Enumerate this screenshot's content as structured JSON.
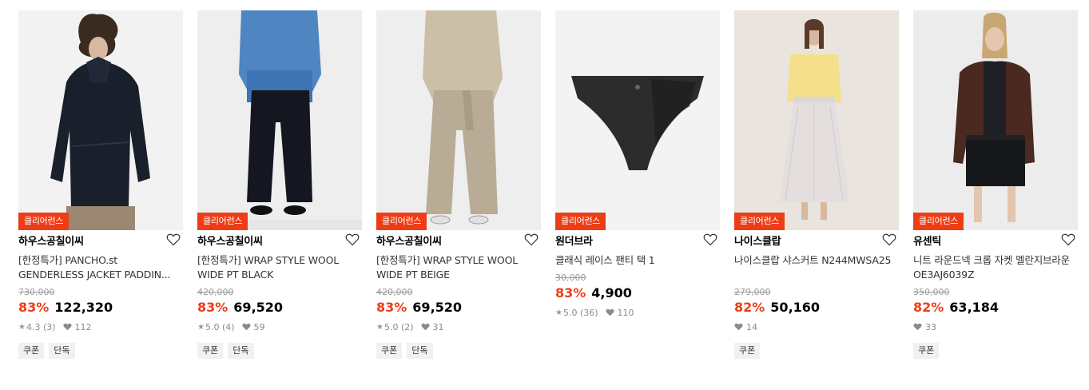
{
  "products": [
    {
      "badge": "클리어런스",
      "brand": "하우스공칠이씨",
      "title": "[한정특가] PANCHO.st GENDERLESS JACKET PADDIN...",
      "original_price": "730,000",
      "discount": "83%",
      "price": "122,320",
      "rating": "4.3 (3)",
      "likes": "112",
      "tags": [
        "쿠폰",
        "단독"
      ],
      "image_icon": "jacket-model-photo"
    },
    {
      "badge": "클리어런스",
      "brand": "하우스공칠이씨",
      "title": "[한정특가] WRAP STYLE WOOL WIDE PT BLACK",
      "original_price": "420,000",
      "discount": "83%",
      "price": "69,520",
      "rating": "5.0 (4)",
      "likes": "59",
      "tags": [
        "쿠폰",
        "단독"
      ],
      "image_icon": "black-pants-photo"
    },
    {
      "badge": "클리어런스",
      "brand": "하우스공칠이씨",
      "title": "[한정특가] WRAP STYLE WOOL WIDE PT BEIGE",
      "original_price": "420,000",
      "discount": "83%",
      "price": "69,520",
      "rating": "5.0 (2)",
      "likes": "31",
      "tags": [
        "쿠폰",
        "단독"
      ],
      "image_icon": "beige-pants-photo"
    },
    {
      "badge": "클리어런스",
      "brand": "원더브라",
      "title": "클래식 레이스 팬티 택 1",
      "original_price": "30,000",
      "discount": "83%",
      "price": "4,900",
      "rating": "5.0 (36)",
      "likes": "110",
      "tags": [],
      "image_icon": "lace-panty-photo"
    },
    {
      "badge": "클리어런스",
      "brand": "나이스클랍",
      "title": "나이스클랍 샤스커트 N244MWSA25",
      "original_price": "279,000",
      "discount": "82%",
      "price": "50,160",
      "rating": "",
      "likes": "14",
      "tags": [
        "쿠폰"
      ],
      "image_icon": "sheer-skirt-photo"
    },
    {
      "badge": "클리어런스",
      "brand": "유센틱",
      "title": "니트 라운드넥 크롭 자켓 멜란지브라운 OE3AJ6039Z",
      "original_price": "350,000",
      "discount": "82%",
      "price": "63,184",
      "rating": "",
      "likes": "33",
      "tags": [
        "쿠폰"
      ],
      "image_icon": "cropped-jacket-photo"
    }
  ],
  "colors": {
    "accent": "#ee3d16",
    "strike_price": "#9a9a9a",
    "tag_bg": "#f1f1f1"
  }
}
